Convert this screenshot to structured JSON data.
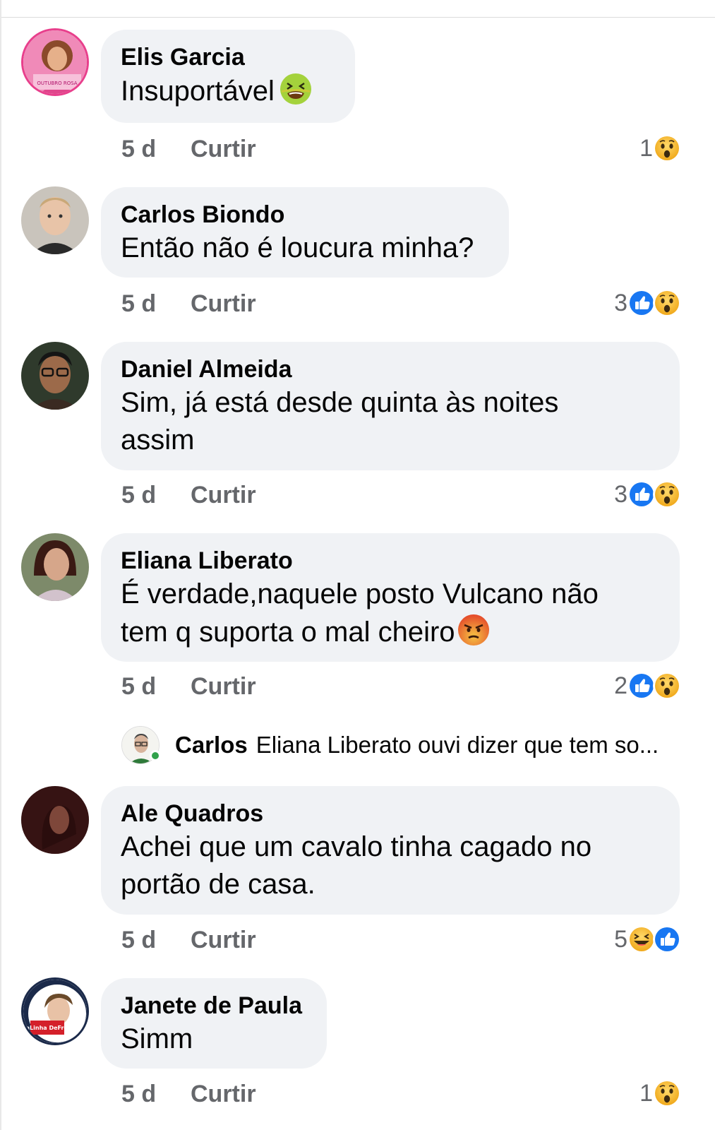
{
  "comments": [
    {
      "author": "Elis Garcia",
      "text": "Insuportável",
      "emoji": "nauseated-face-emoji",
      "time": "5 d",
      "like": "Curtir",
      "reaction_count": "1",
      "reactions": [
        "wow"
      ]
    },
    {
      "author": "Carlos Biondo",
      "text": "Então não é loucura minha?",
      "time": "5 d",
      "like": "Curtir",
      "reaction_count": "3",
      "reactions": [
        "like",
        "wow"
      ]
    },
    {
      "author": "Daniel Almeida",
      "text": "Sim, já está desde quinta às noites assim",
      "time": "5 d",
      "like": "Curtir",
      "reaction_count": "3",
      "reactions": [
        "like",
        "wow"
      ]
    },
    {
      "author": "Eliana Liberato",
      "text": "É verdade,naquele posto Vulcano não tem q suporta o mal cheiro",
      "emoji": "angry-face-emoji",
      "time": "5 d",
      "like": "Curtir",
      "reaction_count": "2",
      "reactions": [
        "like",
        "wow"
      ]
    },
    {
      "author": "Ale Quadros",
      "text": "Achei que um cavalo tinha cagado no portão de casa.",
      "time": "5 d",
      "like": "Curtir",
      "reaction_count": "5",
      "reactions": [
        "haha",
        "like"
      ]
    },
    {
      "author": "Janete de Paula",
      "text": "Simm",
      "time": "5 d",
      "like": "Curtir",
      "reaction_count": "1",
      "reactions": [
        "wow"
      ]
    }
  ],
  "reply": {
    "author": "Carlos",
    "text": "Eliana Liberato ouvi dizer que tem so..."
  },
  "avatar_texts": {
    "elis": "OUTUBRO ROSA",
    "janete": "#NaLinha DeFrente"
  },
  "colors": {
    "bubble": "#f0f2f5",
    "meta": "#65676b",
    "like_blue": "#1877f2",
    "emoji_yellow": "#f7b125",
    "online": "#31a24c"
  }
}
